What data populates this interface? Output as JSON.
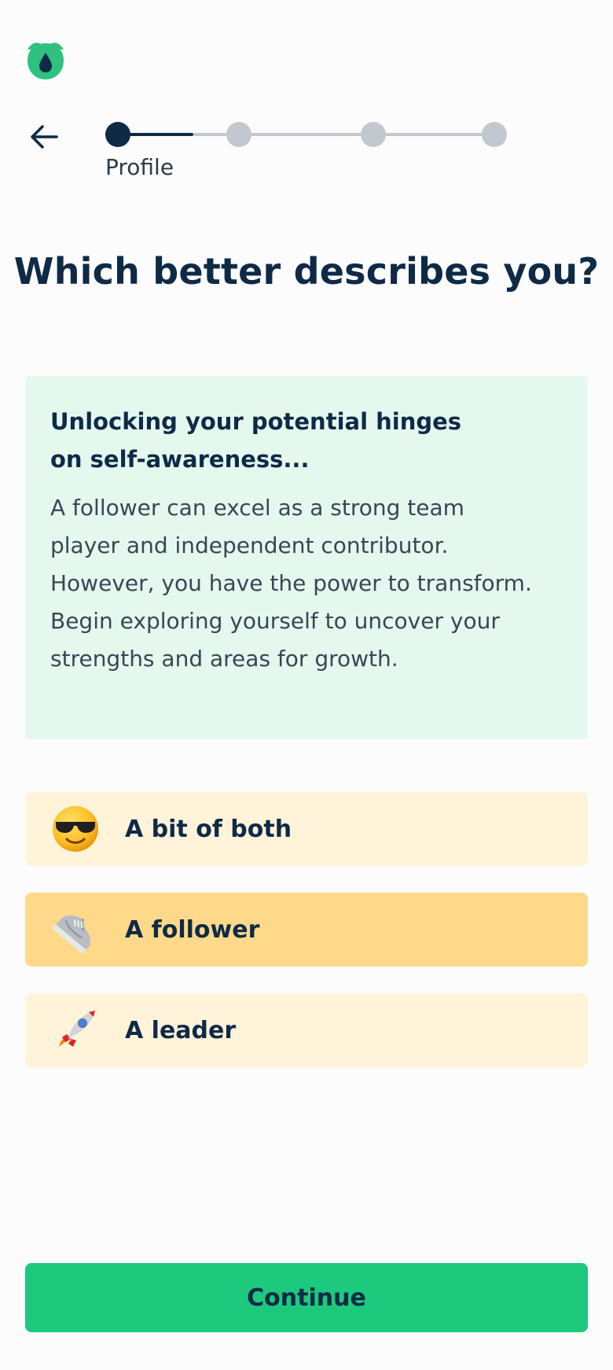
{
  "stepper": {
    "current_step_label": "Profile",
    "current_step": 1,
    "total_steps": 4
  },
  "question": {
    "title": "Which better describes you?"
  },
  "info_card": {
    "heading": "Unlocking your potential hinges on self-awareness...",
    "body": "A follower can excel as a strong team player and independent contributor. However, you have the power to transform. Begin exploring yourself to uncover your strengths and areas for growth."
  },
  "options": [
    {
      "label": "A bit of both",
      "icon": "sunglasses-face-icon",
      "selected": false
    },
    {
      "label": "A follower",
      "icon": "sneaker-icon",
      "selected": true
    },
    {
      "label": "A leader",
      "icon": "rocket-icon",
      "selected": false
    }
  ],
  "actions": {
    "continue_label": "Continue"
  },
  "colors": {
    "brand_green": "#1dc97c",
    "navy": "#0e2a47",
    "info_bg": "#e4f8ee",
    "option_bg": "#fff3d9",
    "option_selected_bg": "#ffd98a"
  }
}
